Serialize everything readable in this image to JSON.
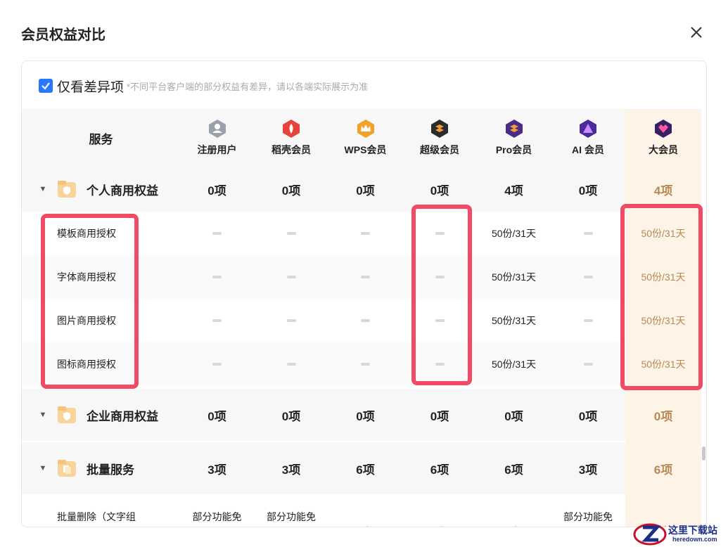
{
  "dialog": {
    "title": "会员权益对比"
  },
  "filter": {
    "checked": true,
    "label": "仅看差异项",
    "note": "*不同平台客户端的部分权益有差异，请以各端实际展示为准"
  },
  "columns": {
    "service_header": "服务",
    "tiers": [
      {
        "label": "注册用户",
        "icon": "user-badge-icon",
        "color": "#9aa0ad"
      },
      {
        "label": "稻壳会员",
        "icon": "docer-badge-icon",
        "color": "#e5443b"
      },
      {
        "label": "WPS会员",
        "icon": "wps-crown-badge-icon",
        "color": "#f2a22b"
      },
      {
        "label": "超级会员",
        "icon": "super-badge-icon",
        "color": "#2b2b2b"
      },
      {
        "label": "Pro会员",
        "icon": "pro-badge-icon",
        "color": "#4a2c86"
      },
      {
        "label": "AI 会员",
        "icon": "ai-badge-icon",
        "color": "#4b2a9a"
      },
      {
        "label": "大会员",
        "icon": "big-member-badge-icon",
        "color": "#3a1f66"
      }
    ]
  },
  "groups": [
    {
      "label": "个人商用权益",
      "counts": [
        "0项",
        "0项",
        "0项",
        "0项",
        "4项",
        "0项",
        "4项"
      ],
      "items": [
        {
          "label": "模板商用授权",
          "values": [
            "",
            "",
            "",
            "",
            "50份/31天",
            "",
            "50份/31天"
          ]
        },
        {
          "label": "字体商用授权",
          "values": [
            "",
            "",
            "",
            "",
            "50份/31天",
            "",
            "50份/31天"
          ]
        },
        {
          "label": "图片商用授权",
          "values": [
            "",
            "",
            "",
            "",
            "50份/31天",
            "",
            "50份/31天"
          ]
        },
        {
          "label": "图标商用授权",
          "values": [
            "",
            "",
            "",
            "",
            "50份/31天",
            "",
            "50份/31天"
          ]
        }
      ]
    },
    {
      "label": "企业商用权益",
      "counts": [
        "0项",
        "0项",
        "0项",
        "0项",
        "0项",
        "0项",
        "0项"
      ]
    },
    {
      "label": "批量服务",
      "counts": [
        "3项",
        "3项",
        "6项",
        "6项",
        "6项",
        "3项",
        "6项"
      ],
      "partial_item": {
        "label": "批量删除（文字组",
        "values": [
          "部分功能免",
          "部分功能免",
          "",
          "",
          "",
          "部分功能免",
          ""
        ]
      }
    }
  ],
  "watermark": {
    "title": "这里下载站",
    "url": "heredown.com"
  },
  "colors": {
    "accent": "#2878ff",
    "highlight": "#f04a64",
    "big_member": "#b58a55",
    "big_member_bg": "#fdf3e7"
  }
}
